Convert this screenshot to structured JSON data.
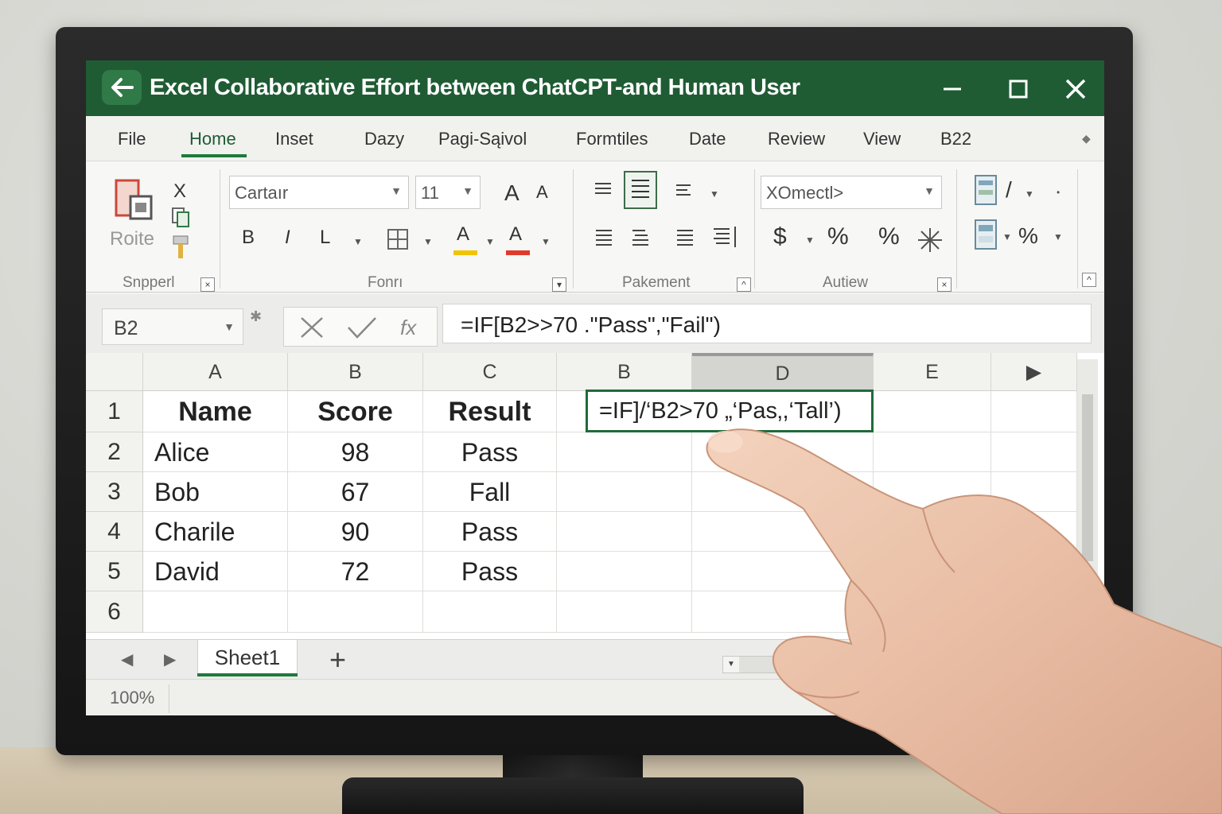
{
  "window": {
    "title": "Excel Collaborative Effort between ChatCPT-and Human User"
  },
  "menu": [
    "File",
    "Home",
    "Inset",
    "Dazy",
    "Pagi-Sąivol",
    "Formtiles",
    "Date",
    "Review",
    "View",
    "B22"
  ],
  "ribbon": {
    "clipboard": {
      "paste_label": "Roite",
      "cut_label": "X",
      "group_label": "Snpperl"
    },
    "font": {
      "font_name": "Cartaır",
      "font_size": "11",
      "grow_label": "A",
      "shrink_label": "A",
      "bold": "B",
      "italic": "I",
      "underline": "L",
      "fill_label": "A",
      "color_label": "A",
      "group_label": "Fonrı",
      "fill_bar_color": "#f2c400",
      "font_bar_color": "#e03a2c"
    },
    "alignment": {
      "group_label": "Pakement"
    },
    "number": {
      "format": "XOmectl>",
      "currency": "$",
      "percent": "%",
      "percent2": "%",
      "group_label": "Autiew"
    },
    "cells": {
      "percent": "%"
    }
  },
  "formula_bar": {
    "name_box": "B2",
    "formula": "=IF[B2>>70 .\"Pass\",\"Fail\")",
    "fx_label": "fx"
  },
  "grid": {
    "columns": [
      "A",
      "B",
      "C",
      "B",
      "D",
      "E"
    ],
    "rows": [
      "1",
      "2",
      "3",
      "4",
      "5",
      "6"
    ],
    "header": {
      "name": "Name",
      "score": "Score",
      "result": "Result"
    },
    "data": [
      {
        "name": "Alice",
        "score": "98",
        "result": "Pass"
      },
      {
        "name": "Bob",
        "score": "67",
        "result": "Fall"
      },
      {
        "name": "Charile",
        "score": "90",
        "result": "Pass"
      },
      {
        "name": "David",
        "score": "72",
        "result": "Pass"
      }
    ],
    "active_cell_text": "=IF]/‘B2>70 „‘Pas‚,‘Tall’)"
  },
  "sheets": {
    "tabs": [
      "Sheet1"
    ],
    "add_label": "+"
  },
  "status": {
    "zoom": "100%"
  },
  "colors": {
    "titlebar": "#1f5c34",
    "accent": "#1f7a3c"
  }
}
